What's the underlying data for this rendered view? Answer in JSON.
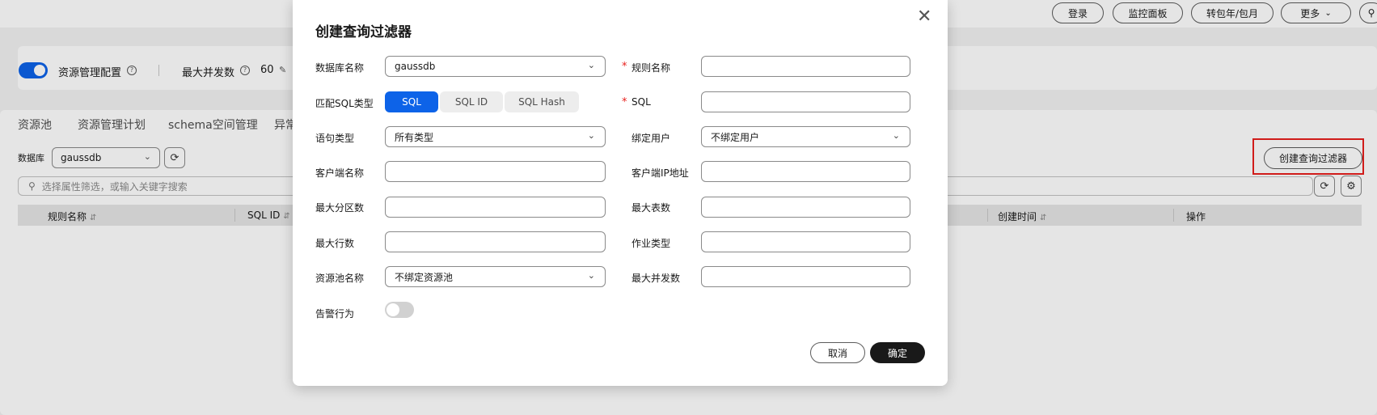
{
  "topbar": {
    "login": "登录",
    "monitor": "监控面板",
    "renew": "转包年/包月",
    "more": "更多"
  },
  "resource_config": {
    "label": "资源管理配置",
    "enabled": true,
    "max_concurrency_label": "最大并发数",
    "max_concurrency_value": "60"
  },
  "tabs": [
    "资源池",
    "资源管理计划",
    "schema空间管理",
    "异常"
  ],
  "filter": {
    "db_label": "数据库",
    "db_value": "gaussdb",
    "search_placeholder": "选择属性筛选，或输入关键字搜索"
  },
  "table": {
    "columns": [
      "规则名称",
      "SQL ID",
      "创建时间",
      "操作"
    ]
  },
  "create_button": "创建查询过滤器",
  "modal": {
    "title": "创建查询过滤器",
    "fields": {
      "db_name_label": "数据库名称",
      "db_name_value": "gaussdb",
      "rule_name_label": "规则名称",
      "match_type_label": "匹配SQL类型",
      "match_types": [
        "SQL",
        "SQL ID",
        "SQL Hash"
      ],
      "sql_label": "SQL",
      "stmt_type_label": "语句类型",
      "stmt_type_value": "所有类型",
      "bind_user_label": "绑定用户",
      "bind_user_value": "不绑定用户",
      "client_name_label": "客户端名称",
      "client_ip_label": "客户端IP地址",
      "max_partition_label": "最大分区数",
      "max_tables_label": "最大表数",
      "max_rows_label": "最大行数",
      "job_type_label": "作业类型",
      "pool_name_label": "资源池名称",
      "pool_name_value": "不绑定资源池",
      "max_concurrency_label": "最大并发数",
      "alarm_label": "告警行为",
      "alarm_enabled": false
    },
    "cancel": "取消",
    "ok": "确定"
  }
}
